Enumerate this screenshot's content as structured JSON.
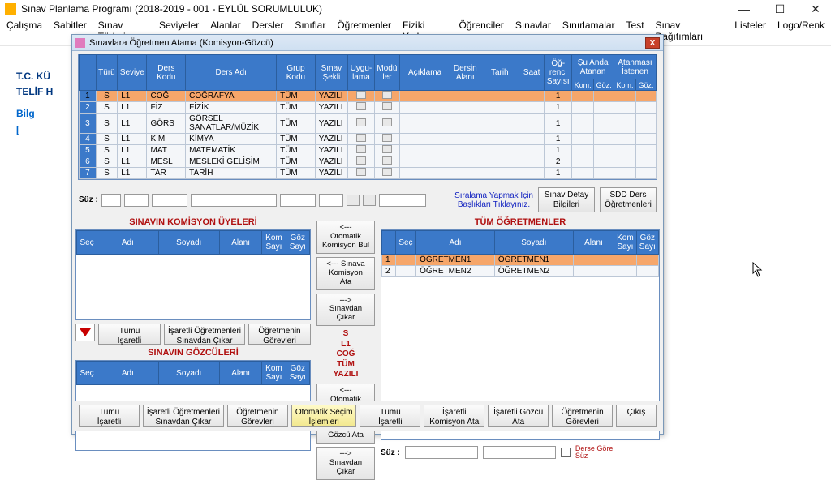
{
  "app": {
    "title": "Sınav Planlama Programı (2018-2019 - 001 - EYLÜL SORUMLULUK)",
    "win_min": "—",
    "win_max": "☐",
    "win_close": "✕"
  },
  "menu": [
    "Çalışma",
    "Sabitler",
    "Sınav Türleri",
    "Seviyeler",
    "Alanlar",
    "Dersler",
    "Sınıflar",
    "Öğretmenler",
    "Fiziki Yerler",
    "Öğrenciler",
    "Sınavlar",
    "Sınırlamalar",
    "Test",
    "Sınav Dağıtımları",
    "Listeler",
    "Logo/Renk"
  ],
  "bg": {
    "l1": "T.C. KÜ",
    "l2": "TELİF H",
    "l3": "Bilg",
    "l4": "[",
    "l5": ""
  },
  "dialog": {
    "title": "Sınavlara Öğretmen Atama (Komisyon-Gözcü)"
  },
  "main_headers": {
    "turu": "Türü",
    "seviye": "Seviye",
    "dersKodu": "Ders Kodu",
    "dersAdi": "Ders Adı",
    "grupKodu": "Grup Kodu",
    "sinavSekli": "Sınav\nŞekli",
    "uygulama": "Uygu-\nlama",
    "modul": "Modü\nler",
    "aciklama": "Açıklama",
    "dersinAlani": "Dersin\nAlanı",
    "tarih": "Tarih",
    "saat": "Saat",
    "ogrenciSayisi": "Öğ-\nrenci\nSayısı",
    "suAnda": "Şu Anda\nAtanan",
    "istenen": "Atanması\nİstenen",
    "kom": "Kom.",
    "goz": "Göz."
  },
  "rows": [
    {
      "n": "1",
      "turu": "S",
      "seviye": "L1",
      "kod": "COĞ",
      "ad": "COĞRAFYA",
      "grup": "TÜM",
      "sekli": "YAZILI",
      "ogr": "1",
      "sel": true
    },
    {
      "n": "2",
      "turu": "S",
      "seviye": "L1",
      "kod": "FİZ",
      "ad": "FİZİK",
      "grup": "TÜM",
      "sekli": "YAZILI",
      "ogr": "1"
    },
    {
      "n": "3",
      "turu": "S",
      "seviye": "L1",
      "kod": "GÖRS",
      "ad": "GÖRSEL SANATLAR/MÜZİK",
      "grup": "TÜM",
      "sekli": "YAZILI",
      "ogr": "1"
    },
    {
      "n": "4",
      "turu": "S",
      "seviye": "L1",
      "kod": "KİM",
      "ad": "KİMYA",
      "grup": "TÜM",
      "sekli": "YAZILI",
      "ogr": "1"
    },
    {
      "n": "5",
      "turu": "S",
      "seviye": "L1",
      "kod": "MAT",
      "ad": "MATEMATİK",
      "grup": "TÜM",
      "sekli": "YAZILI",
      "ogr": "1"
    },
    {
      "n": "6",
      "turu": "S",
      "seviye": "L1",
      "kod": "MESL",
      "ad": "MESLEKİ GELİŞİM",
      "grup": "TÜM",
      "sekli": "YAZILI",
      "ogr": "2"
    },
    {
      "n": "7",
      "turu": "S",
      "seviye": "L1",
      "kod": "TAR",
      "ad": "TARİH",
      "grup": "TÜM",
      "sekli": "YAZILI",
      "ogr": "1"
    }
  ],
  "filter_label": "Süz :",
  "sort_hint": "Sıralama Yapmak İçin\nBaşlıkları Tıklayınız.",
  "btn_detail": "Sınav Detay\nBilgileri",
  "btn_sdd": "SDD Ders\nÖğretmenleri",
  "titles": {
    "komisyon": "SINAVIN KOMİSYON ÜYELERİ",
    "gozcu": "SINAVIN GÖZCÜLERİ",
    "tumog": "TÜM ÖĞRETMENLER"
  },
  "subgrid_headers": {
    "sec": "Seç",
    "adi": "Adı",
    "soyadi": "Soyadı",
    "alani": "Alanı",
    "komSayi": "Kom\nSayı",
    "gozSayi": "Göz\nSayı"
  },
  "mid_buttons": {
    "k1": "<---\nOtomatik\nKomisyon Bul",
    "k2": "<--- Sınava\nKomisyon\nAta",
    "k3": "--->\nSınavdan\nÇıkar",
    "g1": "<---\nOtomatik\nGözcü Bul",
    "g2": "<--- Sınava\nGözcü Ata",
    "g3": "--->\nSınavdan\nÇıkar"
  },
  "mid_selected": "S\nL1\nCOĞ\nTÜM\nYAZILI",
  "left_btns": {
    "b1": "Tümü\nİşaretli",
    "b2": "İşaretli Öğretmenleri\nSınavdan Çıkar",
    "b3": "Öğretmenin\nGörevleri"
  },
  "teachers": [
    {
      "n": "1",
      "adi": "ÖĞRETMEN1",
      "soyadi": "ÖĞRETMEN1",
      "sel": true
    },
    {
      "n": "2",
      "adi": "ÖĞRETMEN2",
      "soyadi": "ÖĞRETMEN2"
    }
  ],
  "right_suz": "Süz :",
  "right_chk": "Derse Göre\nSüz",
  "bottom": {
    "b1": "Tümü\nİşaretli",
    "b2": "İşaretli Öğretmenleri\nSınavdan Çıkar",
    "b3": "Öğretmenin\nGörevleri",
    "b4": "Otomatik Seçim\nİşlemleri",
    "b5": "Tümü\nİşaretli",
    "b6": "İşaretli\nKomisyon Ata",
    "b7": "İşaretli Gözcü\nAta",
    "b8": "Öğretmenin\nGörevleri",
    "b9": "Çıkış"
  }
}
